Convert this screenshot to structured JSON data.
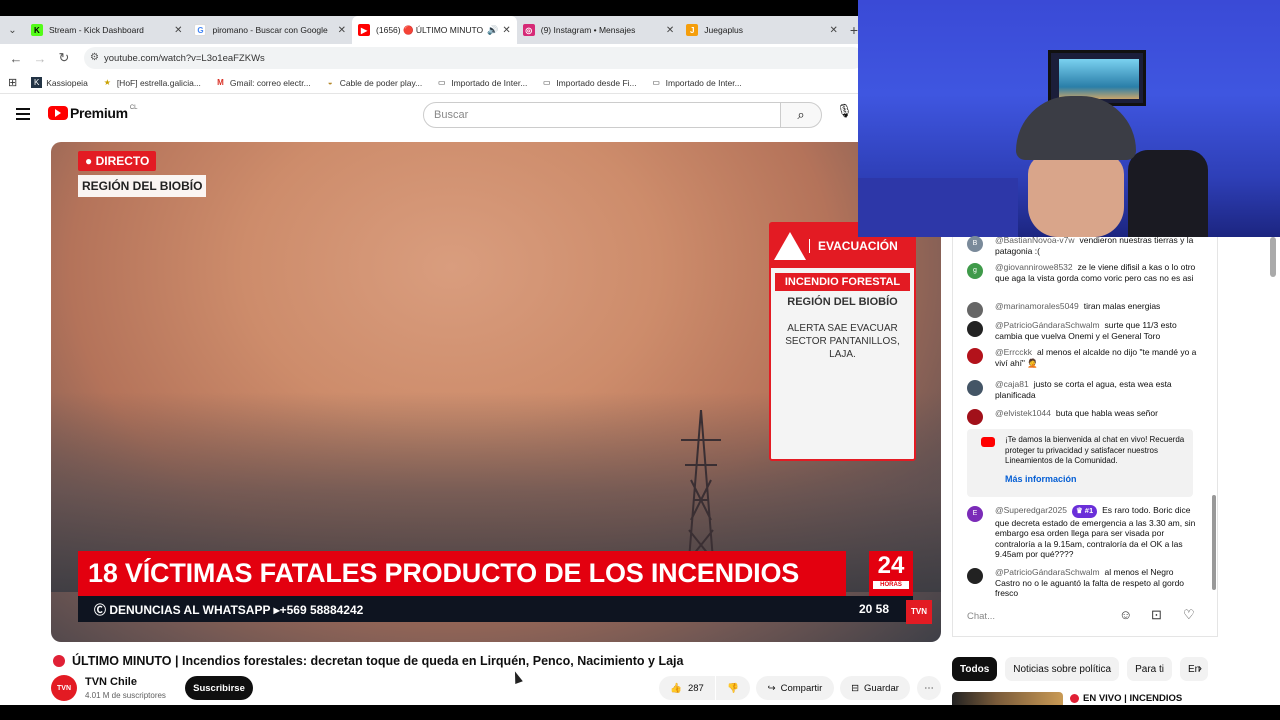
{
  "browser": {
    "tabs": [
      {
        "title": "Stream - Kick Dashboard",
        "icon": "kick-icon",
        "color": "#53fc18"
      },
      {
        "title": "piromano - Buscar con Google",
        "icon": "google-icon",
        "color": "#4285f4"
      },
      {
        "title": "(1656) 🔴 ÚLTIMO MINUTO",
        "icon": "youtube-icon",
        "color": "#ff0000",
        "active": true
      },
      {
        "title": "(9) Instagram • Mensajes",
        "icon": "instagram-icon",
        "color": "#d62976"
      },
      {
        "title": "Juegaplus",
        "icon": "juegaplus-icon",
        "color": "#f59e0b"
      }
    ],
    "url": "youtube.com/watch?v=L3o1eaFZKWs",
    "bookmarks": [
      {
        "label": "Kassiopeia",
        "icon": "kassiopeia-icon"
      },
      {
        "label": "[HoF] estrella.galicia...",
        "icon": "hof-icon"
      },
      {
        "label": "Gmail: correo electr...",
        "icon": "gmail-icon"
      },
      {
        "label": "Cable de poder play...",
        "icon": "cable-icon"
      },
      {
        "label": "Importado de Inter...",
        "icon": "folder-icon"
      },
      {
        "label": "Importado desde Fi...",
        "icon": "folder-icon"
      },
      {
        "label": "Importado de Inter...",
        "icon": "folder-icon"
      }
    ]
  },
  "youtube": {
    "brand": "Premium",
    "country": "CL",
    "search_placeholder": "Buscar"
  },
  "video": {
    "overlay": {
      "directo": "● DIRECTO",
      "region": "REGIÓN DEL BIOBÍO",
      "evac_title": "EVACUACIÓN",
      "evac_subtitle": "INCENDIO FORESTAL",
      "evac_region": "REGIÓN DEL BIOBÍO",
      "evac_text": "ALERTA SAE EVACUAR SECTOR PANTANILLOS, LAJA.",
      "lower_third": "18 VÍCTIMAS FATALES PRODUCTO DE LOS INCENDIOS",
      "channel_number": "24",
      "channel_label": "HORAS",
      "ticker": "Ⓒ DENUNCIAS AL WHATSAPP ▸+569 58884242",
      "ticker_time": "20 58",
      "bug": "TVN"
    },
    "title": "ÚLTIMO MINUTO | Incendios forestales: decretan toque de queda en Lirquén, Penco, Nacimiento y Laja",
    "channel": "TVN Chile",
    "channel_avatar": "TVN",
    "subscribers": "4.01 M de suscriptores",
    "subscribe": "Suscribirse",
    "likes": "287",
    "share": "Compartir",
    "save": "Guardar"
  },
  "chat": {
    "messages": [
      {
        "author": "@BastianNovoa-v7w",
        "text": "vendieron nuestras tierras y la patagonia :(",
        "avatar": "B",
        "color": "#7a8a9a"
      },
      {
        "author": "@giovannirowe8532",
        "text": "ze le viene difisil a kas o lo otro que aga la vista gorda como voric pero cas no es asi",
        "avatar": "g",
        "color": "#3f9a4a"
      },
      {
        "author": "@marinamorales5049",
        "text": "tiran malas energias",
        "avatar": "",
        "color": "#666666"
      },
      {
        "author": "@PatricioGándaraSchwalm",
        "text": "surte que 11/3 esto cambia que vuelva Onemi y el General Toro",
        "avatar": "",
        "color": "#222222"
      },
      {
        "author": "@Errcckk",
        "text": "al menos el alcalde no dijo \"te mandé yo a viví ahí\" 🤦",
        "avatar": "",
        "color": "#b3121b"
      },
      {
        "author": "@caja81",
        "text": "justo se corta el agua, esta wea esta planificada",
        "avatar": "",
        "color": "#445566"
      },
      {
        "author": "@elvistek1044",
        "text": "buta que habla weas señor",
        "avatar": "",
        "color": "#a1101a"
      }
    ],
    "welcome": {
      "text": "¡Te damos la bienvenida al chat en vivo! Recuerda proteger tu privacidad y satisfacer nuestros Lineamientos de la Comunidad.",
      "more": "Más información"
    },
    "after": [
      {
        "author": "@Superedgar2025",
        "badge": "♛ #1",
        "text": "Es raro todo. Boric dice que decreta estado de emergencia a las 3.30 am, sin embargo esa orden llega para ser visada por contraloría a la 9.15am, contraloría da el OK a las 9.45am por qué????",
        "avatar": "E",
        "color": "#7b2bb8"
      },
      {
        "author": "@PatricioGándaraSchwalm",
        "text": "al menos el Negro Castro no o le aguantó la falta de respeto al gordo fresco",
        "avatar": "",
        "color": "#222222"
      }
    ],
    "input_placeholder": "Chat..."
  },
  "chips": [
    "Todos",
    "Noticias sobre política",
    "Para ti",
    "En"
  ],
  "recommendation": {
    "title": "EN VIVO | INCENDIOS"
  }
}
